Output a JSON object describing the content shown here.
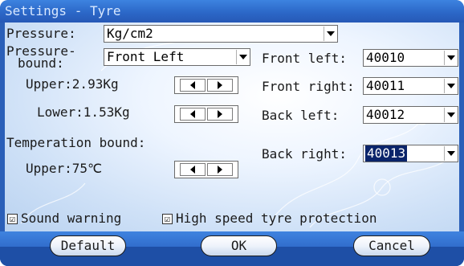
{
  "window": {
    "title": "Settings - Tyre"
  },
  "pressure": {
    "label": "Pressure:",
    "unit_value": "Kg/cm2"
  },
  "pressure_bound": {
    "label_line1": "Pressure-",
    "label_line2": "bound:",
    "position_value": "Front Left",
    "upper_label": "Upper:2.93Kg",
    "lower_label": "Lower:1.53Kg"
  },
  "temperature_bound": {
    "label": "Temperation bound:",
    "upper_label": "Upper:75℃"
  },
  "sensors": {
    "front_left": {
      "label": "Front left:",
      "value": "40010"
    },
    "front_right": {
      "label": "Front right:",
      "value": "40011"
    },
    "back_left": {
      "label": "Back left:",
      "value": "40012"
    },
    "back_right": {
      "label": "Back right:",
      "value": "40013"
    }
  },
  "options": {
    "sound_warning": {
      "label": "Sound warning",
      "checked": true,
      "mark": "☑"
    },
    "high_speed": {
      "label": "High speed tyre protection",
      "checked": true,
      "mark": "☑"
    }
  },
  "buttons": {
    "default": "Default",
    "ok": "OK",
    "cancel": "Cancel"
  },
  "colors": {
    "title_bar": "#2c68c8",
    "selection": "#0a246a",
    "bottom_bar": "#2556b3"
  }
}
